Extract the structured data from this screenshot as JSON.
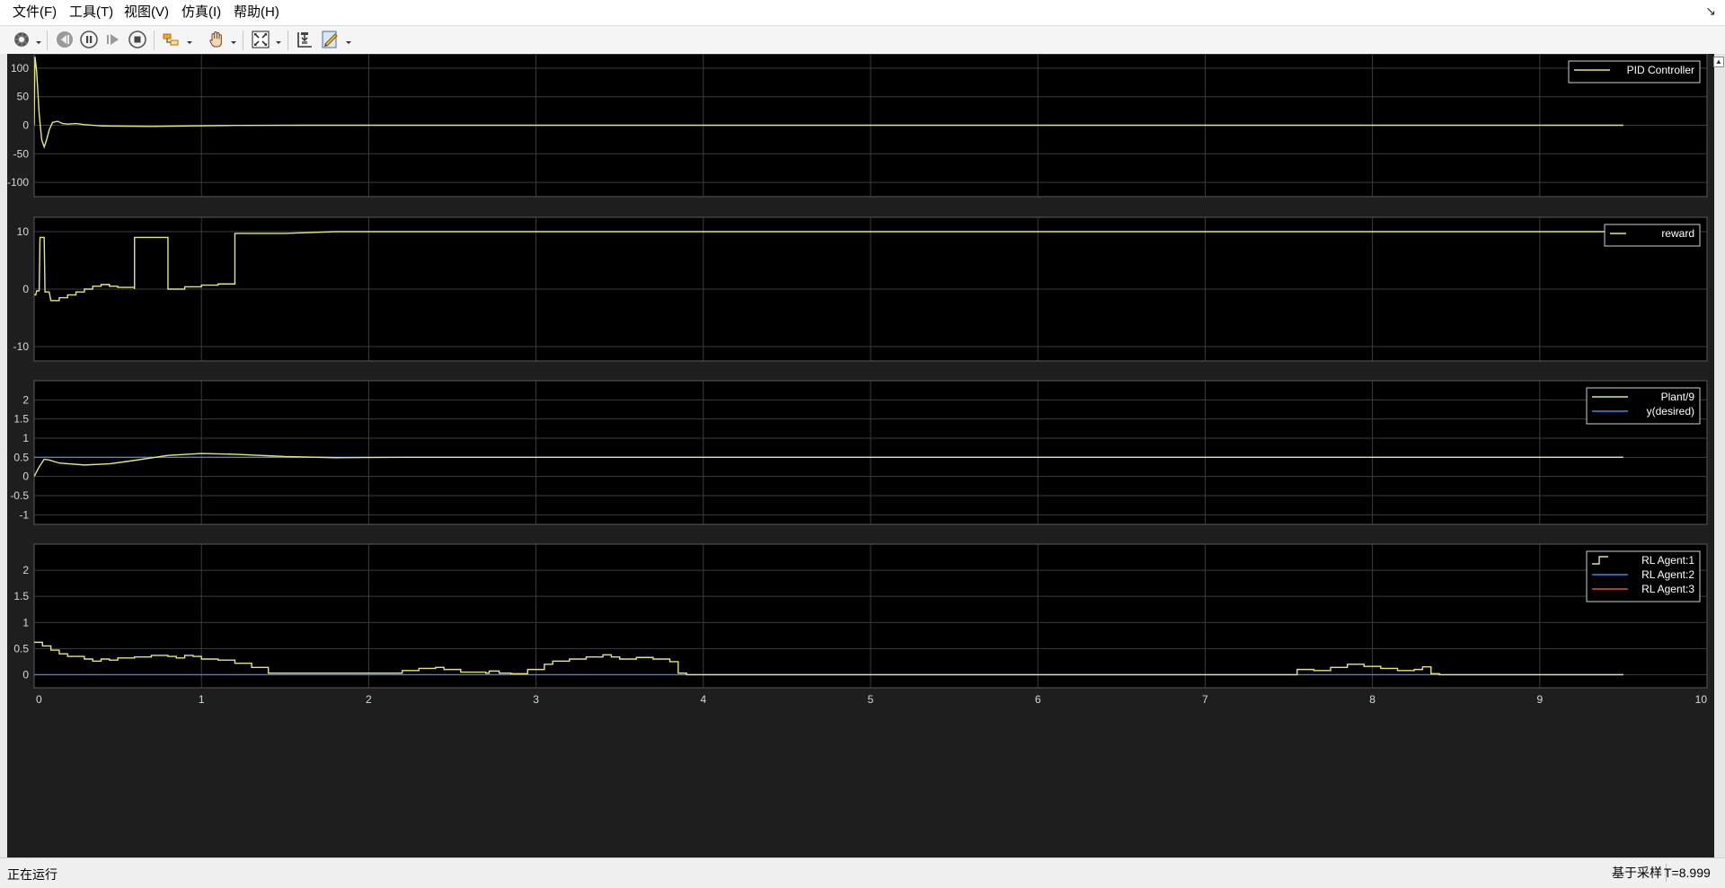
{
  "menu": {
    "file": "文件(F)",
    "tools": "工具(T)",
    "view": "视图(V)",
    "simulation": "仿真(I)",
    "help": "帮助(H)"
  },
  "toolbar": {
    "icons": [
      "settings-icon",
      "step-back-icon",
      "pause-icon",
      "step-forward-icon",
      "stop-icon",
      "highlight-icon",
      "pan-icon",
      "zoom-fit-icon",
      "zoom-axes-icon",
      "measure-icon"
    ]
  },
  "status": {
    "text": "正在运行",
    "mode": "基于采样",
    "time": "T=8.999"
  },
  "colors": {
    "background": "#000000",
    "grid": "#3c3c3c",
    "yellow": "#e6e677",
    "blue": "#3d87d9",
    "red": "#d9533f"
  },
  "chart_data": [
    {
      "type": "line",
      "title": "",
      "xlim": [
        0,
        10
      ],
      "ylim": [
        -125,
        125
      ],
      "yticks": [
        100,
        50,
        0,
        -50,
        -100
      ],
      "xticks": [],
      "grid": true,
      "legend_placement": "top-right",
      "series": [
        {
          "name": "PID Controller",
          "color": "#e6e677",
          "step": false,
          "points": [
            [
              0,
              0
            ],
            [
              0.005,
              120
            ],
            [
              0.015,
              95
            ],
            [
              0.03,
              20
            ],
            [
              0.045,
              -25
            ],
            [
              0.06,
              -38
            ],
            [
              0.075,
              -25
            ],
            [
              0.09,
              -8
            ],
            [
              0.11,
              5
            ],
            [
              0.14,
              7
            ],
            [
              0.17,
              3
            ],
            [
              0.2,
              2
            ],
            [
              0.25,
              3
            ],
            [
              0.3,
              1
            ],
            [
              0.4,
              -1
            ],
            [
              0.5,
              -1.5
            ],
            [
              0.7,
              -2
            ],
            [
              0.9,
              -1.2
            ],
            [
              1.2,
              -0.3
            ],
            [
              1.6,
              0
            ],
            [
              9.5,
              0
            ]
          ]
        }
      ]
    },
    {
      "type": "line",
      "title": "",
      "xlim": [
        0,
        10
      ],
      "ylim": [
        -12.5,
        12.5
      ],
      "yticks": [
        10,
        0,
        -10
      ],
      "xticks": [],
      "grid": true,
      "legend_placement": "top-right",
      "series": [
        {
          "name": "reward",
          "color": "#e6e677",
          "step": false,
          "points": [
            [
              0,
              -1
            ],
            [
              0.01,
              -1
            ],
            [
              0.015,
              -0.3
            ],
            [
              0.03,
              -0.3
            ],
            [
              0.035,
              9
            ],
            [
              0.06,
              9
            ],
            [
              0.065,
              -0.5
            ],
            [
              0.09,
              -0.5
            ],
            [
              0.1,
              -2
            ],
            [
              0.15,
              -2
            ],
            [
              0.15,
              -1.5
            ],
            [
              0.2,
              -1.5
            ],
            [
              0.2,
              -1
            ],
            [
              0.25,
              -1
            ],
            [
              0.25,
              -0.5
            ],
            [
              0.3,
              -0.5
            ],
            [
              0.3,
              0
            ],
            [
              0.35,
              0
            ],
            [
              0.35,
              0.5
            ],
            [
              0.4,
              0.5
            ],
            [
              0.4,
              0.8
            ],
            [
              0.45,
              0.8
            ],
            [
              0.45,
              0.5
            ],
            [
              0.5,
              0.5
            ],
            [
              0.5,
              0.3
            ],
            [
              0.6,
              0.3
            ],
            [
              0.6,
              0
            ],
            [
              0.6,
              9
            ],
            [
              0.8,
              9
            ],
            [
              0.8,
              0
            ],
            [
              0.9,
              0
            ],
            [
              0.9,
              0.4
            ],
            [
              1.0,
              0.4
            ],
            [
              1.0,
              0.7
            ],
            [
              1.1,
              0.7
            ],
            [
              1.1,
              0.9
            ],
            [
              1.2,
              0.9
            ],
            [
              1.2,
              9.7
            ],
            [
              1.5,
              9.7
            ],
            [
              1.8,
              10
            ],
            [
              9.5,
              10
            ]
          ]
        }
      ]
    },
    {
      "type": "line",
      "title": "",
      "xlim": [
        0,
        10
      ],
      "ylim": [
        -1.25,
        2.5
      ],
      "yticks": [
        2,
        1.5,
        1,
        0.5,
        0,
        -0.5,
        -1
      ],
      "xticks": [],
      "grid": true,
      "legend_placement": "top-right",
      "series": [
        {
          "name": "Plant/9",
          "color": "#e6e677",
          "step": false,
          "points": [
            [
              0,
              0
            ],
            [
              0.03,
              0.25
            ],
            [
              0.06,
              0.45
            ],
            [
              0.09,
              0.43
            ],
            [
              0.15,
              0.35
            ],
            [
              0.3,
              0.3
            ],
            [
              0.45,
              0.33
            ],
            [
              0.6,
              0.42
            ],
            [
              0.8,
              0.55
            ],
            [
              1.0,
              0.6
            ],
            [
              1.2,
              0.58
            ],
            [
              1.5,
              0.52
            ],
            [
              1.8,
              0.49
            ],
            [
              2.2,
              0.5
            ],
            [
              9.5,
              0.5
            ]
          ]
        },
        {
          "name": "y(desired)",
          "color": "#3d87d9",
          "step": false,
          "points": [
            [
              0,
              0.5
            ],
            [
              9.5,
              0.5
            ]
          ]
        }
      ]
    },
    {
      "type": "line",
      "title": "",
      "xlim": [
        0,
        10
      ],
      "ylim": [
        -0.25,
        2.5
      ],
      "yticks": [
        2,
        1.5,
        1,
        0.5,
        0
      ],
      "xticks": [
        0,
        1,
        2,
        3,
        4,
        5,
        6,
        7,
        8,
        9,
        10
      ],
      "grid": true,
      "legend_placement": "top-right",
      "series": [
        {
          "name": "RL Agent:1",
          "color": "#e6e677",
          "step": true,
          "points": [
            [
              0,
              0.62
            ],
            [
              0.05,
              0.55
            ],
            [
              0.1,
              0.47
            ],
            [
              0.15,
              0.4
            ],
            [
              0.2,
              0.35
            ],
            [
              0.3,
              0.3
            ],
            [
              0.35,
              0.26
            ],
            [
              0.4,
              0.3
            ],
            [
              0.45,
              0.28
            ],
            [
              0.5,
              0.32
            ],
            [
              0.6,
              0.34
            ],
            [
              0.7,
              0.37
            ],
            [
              0.8,
              0.35
            ],
            [
              0.85,
              0.32
            ],
            [
              0.9,
              0.37
            ],
            [
              0.95,
              0.35
            ],
            [
              1.0,
              0.3
            ],
            [
              1.1,
              0.28
            ],
            [
              1.2,
              0.22
            ],
            [
              1.3,
              0.14
            ],
            [
              1.4,
              0.03
            ],
            [
              2.1,
              0.03
            ],
            [
              2.2,
              0.08
            ],
            [
              2.3,
              0.12
            ],
            [
              2.4,
              0.14
            ],
            [
              2.45,
              0.1
            ],
            [
              2.55,
              0.05
            ],
            [
              2.7,
              0.03
            ],
            [
              2.72,
              0.07
            ],
            [
              2.78,
              0.03
            ],
            [
              2.85,
              0.02
            ],
            [
              2.95,
              0.1
            ],
            [
              3.05,
              0.2
            ],
            [
              3.1,
              0.26
            ],
            [
              3.2,
              0.3
            ],
            [
              3.3,
              0.34
            ],
            [
              3.4,
              0.38
            ],
            [
              3.45,
              0.34
            ],
            [
              3.5,
              0.3
            ],
            [
              3.6,
              0.33
            ],
            [
              3.7,
              0.3
            ],
            [
              3.8,
              0.25
            ],
            [
              3.85,
              0.03
            ],
            [
              3.9,
              0.0
            ],
            [
              7.5,
              0.0
            ],
            [
              7.55,
              0.1
            ],
            [
              7.65,
              0.08
            ],
            [
              7.75,
              0.14
            ],
            [
              7.85,
              0.2
            ],
            [
              7.95,
              0.16
            ],
            [
              8.05,
              0.12
            ],
            [
              8.15,
              0.08
            ],
            [
              8.25,
              0.1
            ],
            [
              8.3,
              0.15
            ],
            [
              8.35,
              0.02
            ],
            [
              8.4,
              0.0
            ],
            [
              9.5,
              0.0
            ]
          ]
        },
        {
          "name": "RL Agent:2",
          "color": "#3d87d9",
          "step": false,
          "points": [
            [
              0,
              0
            ],
            [
              9.5,
              0
            ]
          ]
        },
        {
          "name": "RL Agent:3",
          "color": "#d9533f",
          "step": false,
          "points": []
        }
      ]
    }
  ]
}
